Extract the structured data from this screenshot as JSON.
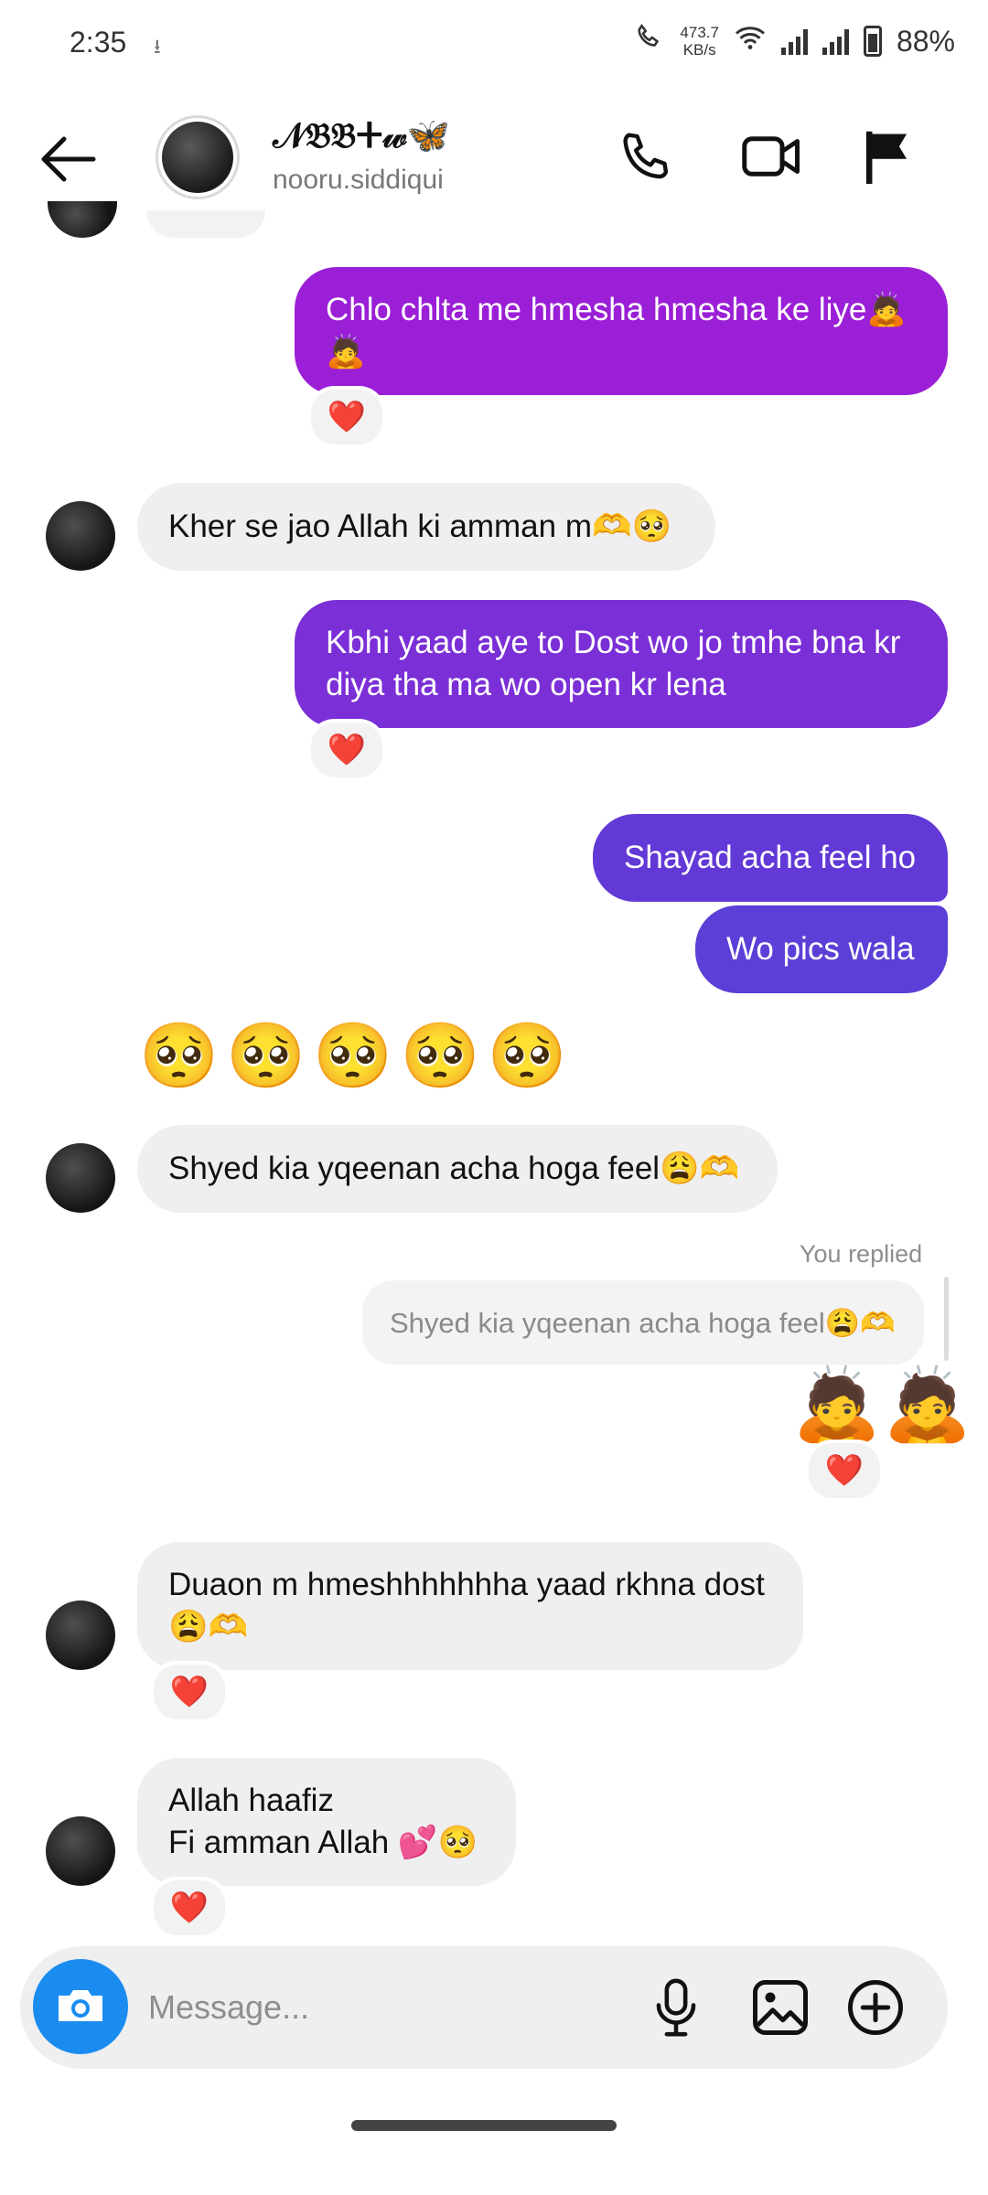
{
  "status_bar": {
    "time": "2:35",
    "speed_value": "473.7",
    "speed_unit": "KB/s",
    "battery": "88%"
  },
  "header": {
    "display_name": "𝒩𝔅𝔅ⵜ𝓌🦋",
    "username": "nooru.siddiqui"
  },
  "messages": [
    {
      "id": "m1",
      "sender": "me",
      "text_line1": "Chlo chlta me hmesha hmesha ke liye🙇",
      "text_line2": "🙇",
      "reaction": "❤️"
    },
    {
      "id": "m2",
      "sender": "them",
      "text": "Kher se jao Allah ki amman m🫶🥺"
    },
    {
      "id": "m3",
      "sender": "me",
      "text_line1": "Kbhi yaad aye to Dost wo jo tmhe bna kr",
      "text_line2": "diya tha ma wo open kr lena",
      "reaction": "❤️"
    },
    {
      "id": "m4",
      "sender": "me",
      "text": "Shayad acha feel ho"
    },
    {
      "id": "m5",
      "sender": "me",
      "text": "Wo pics wala"
    },
    {
      "id": "m6",
      "sender": "them",
      "text": "🥺🥺🥺🥺🥺"
    },
    {
      "id": "m7",
      "sender": "them",
      "text": "Shyed kia yqeenan acha hoga feel😩🫶"
    },
    {
      "id": "m8",
      "sender": "me",
      "reply_label": "You replied",
      "quoted": "Shyed kia yqeenan acha hoga feel😩🫶",
      "text": "🙇🙇",
      "reaction": "❤️"
    },
    {
      "id": "m9",
      "sender": "them",
      "text_line1": "Duaon m hmeshhhhhhha yaad rkhna dost",
      "text_line2": "😩🫶",
      "reaction": "❤️"
    },
    {
      "id": "m10",
      "sender": "them",
      "text_line1": "Allah haafiz",
      "text_line2": "Fi amman Allah 💕🥺",
      "reaction": "❤️"
    }
  ],
  "composer": {
    "placeholder": "Message..."
  },
  "colors": {
    "bubble_top": "#9a1fd6",
    "bubble_mid": "#7b2fd6",
    "bubble_bottom": "#5b3fd6",
    "incoming": "#efefef",
    "camera": "#1a8cf0"
  }
}
